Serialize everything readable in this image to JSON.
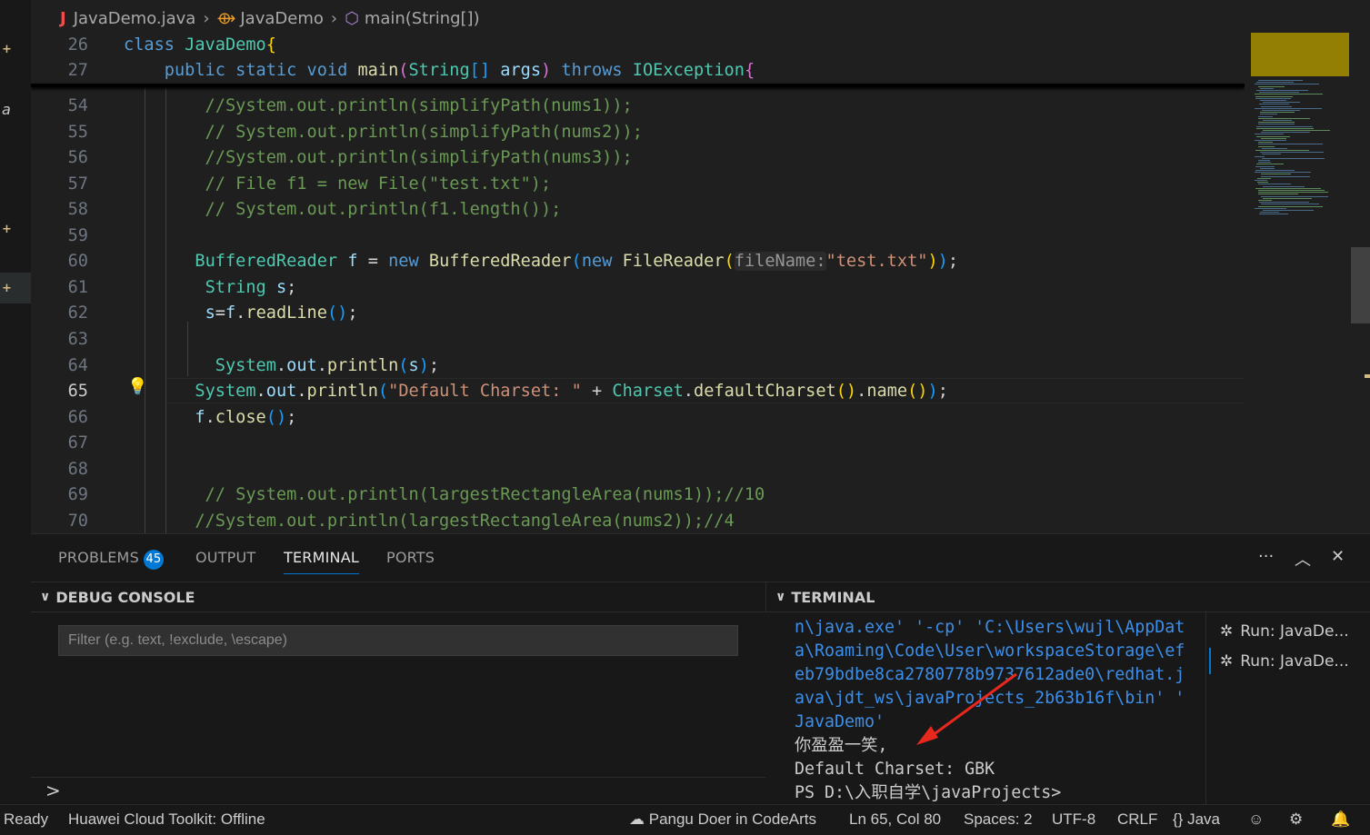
{
  "breadcrumb": {
    "file": "JavaDemo.java",
    "class": "JavaDemo",
    "method": "main(String[])"
  },
  "editor": {
    "sticky": [
      {
        "num": "26",
        "tokens": [
          [
            "kw",
            "class "
          ],
          [
            "ty",
            "JavaDemo"
          ],
          [
            "br1",
            "{"
          ]
        ]
      },
      {
        "num": "27",
        "tokens": [
          [
            "pun",
            "    "
          ],
          [
            "kw",
            "public static void "
          ],
          [
            "fn",
            "main"
          ],
          [
            "br2",
            "("
          ],
          [
            "ty",
            "String"
          ],
          [
            "br3",
            "[]"
          ],
          [
            "pun",
            " "
          ],
          [
            "var",
            "args"
          ],
          [
            "br2",
            ")"
          ],
          [
            "pun",
            " "
          ],
          [
            "kw",
            "throws "
          ],
          [
            "ty",
            "IOException"
          ],
          [
            "br2",
            "{"
          ]
        ]
      }
    ],
    "lines": [
      {
        "num": "54",
        "tokens": [
          [
            "com",
            "        //System.out.println(simplifyPath(nums1));"
          ]
        ]
      },
      {
        "num": "55",
        "tokens": [
          [
            "com",
            "        // System.out.println(simplifyPath(nums2));"
          ]
        ]
      },
      {
        "num": "56",
        "tokens": [
          [
            "com",
            "        //System.out.println(simplifyPath(nums3));"
          ]
        ]
      },
      {
        "num": "57",
        "tokens": [
          [
            "com",
            "        // File f1 = new File(\"test.txt\");"
          ]
        ]
      },
      {
        "num": "58",
        "tokens": [
          [
            "com",
            "        // System.out.println(f1.length());"
          ]
        ]
      },
      {
        "num": "59",
        "tokens": []
      },
      {
        "num": "60",
        "tokens": [
          [
            "pun",
            "       "
          ],
          [
            "ty",
            "BufferedReader"
          ],
          [
            "pun",
            " "
          ],
          [
            "var",
            "f"
          ],
          [
            "pun",
            " = "
          ],
          [
            "kw",
            "new "
          ],
          [
            "fn",
            "BufferedReader"
          ],
          [
            "br3",
            "("
          ],
          [
            "kw",
            "new "
          ],
          [
            "fn",
            "FileReader"
          ],
          [
            "br1",
            "("
          ],
          [
            "hint",
            "fileName:"
          ],
          [
            "str",
            "\"test.txt\""
          ],
          [
            "br1",
            ")"
          ],
          [
            "br3",
            ")"
          ],
          [
            "pun",
            ";"
          ]
        ]
      },
      {
        "num": "61",
        "tokens": [
          [
            "pun",
            "        "
          ],
          [
            "ty",
            "String"
          ],
          [
            "pun",
            " "
          ],
          [
            "var",
            "s"
          ],
          [
            "pun",
            ";"
          ]
        ]
      },
      {
        "num": "62",
        "tokens": [
          [
            "pun",
            "        "
          ],
          [
            "var",
            "s"
          ],
          [
            "pun",
            "="
          ],
          [
            "var",
            "f"
          ],
          [
            "pun",
            "."
          ],
          [
            "fn",
            "readLine"
          ],
          [
            "br3",
            "()"
          ],
          [
            "pun",
            ";"
          ]
        ]
      },
      {
        "num": "63",
        "tokens": []
      },
      {
        "num": "64",
        "tokens": [
          [
            "pun",
            "         "
          ],
          [
            "ty",
            "System"
          ],
          [
            "pun",
            "."
          ],
          [
            "var",
            "out"
          ],
          [
            "pun",
            "."
          ],
          [
            "fn",
            "println"
          ],
          [
            "br3",
            "("
          ],
          [
            "var",
            "s"
          ],
          [
            "br3",
            ")"
          ],
          [
            "pun",
            ";"
          ]
        ]
      },
      {
        "num": "65",
        "tokens": [
          [
            "pun",
            "       "
          ],
          [
            "ty",
            "System"
          ],
          [
            "pun",
            "."
          ],
          [
            "var",
            "out"
          ],
          [
            "pun",
            "."
          ],
          [
            "fn",
            "println"
          ],
          [
            "br3",
            "("
          ],
          [
            "str",
            "\"Default Charset: \""
          ],
          [
            "pun",
            " + "
          ],
          [
            "ty",
            "Charset"
          ],
          [
            "pun",
            "."
          ],
          [
            "fn",
            "defaultCharset"
          ],
          [
            "br1",
            "()"
          ],
          [
            "pun",
            "."
          ],
          [
            "fn",
            "name"
          ],
          [
            "br1",
            "()"
          ],
          [
            "br3",
            ")"
          ],
          [
            "pun",
            ";"
          ]
        ]
      },
      {
        "num": "66",
        "tokens": [
          [
            "pun",
            "       "
          ],
          [
            "var",
            "f"
          ],
          [
            "pun",
            "."
          ],
          [
            "fn",
            "close"
          ],
          [
            "br3",
            "()"
          ],
          [
            "pun",
            ";"
          ]
        ]
      },
      {
        "num": "67",
        "tokens": []
      },
      {
        "num": "68",
        "tokens": []
      },
      {
        "num": "69",
        "tokens": [
          [
            "com",
            "        // System.out.println(largestRectangleArea(nums1));//10"
          ]
        ]
      },
      {
        "num": "70",
        "tokens": [
          [
            "com",
            "       //System.out.println(largestRectangleArea(nums2));//4"
          ]
        ]
      }
    ],
    "current_line": "65"
  },
  "panel": {
    "tabs": [
      "PROBLEMS",
      "OUTPUT",
      "TERMINAL",
      "PORTS"
    ],
    "problems_count": "45",
    "active_tab": "TERMINAL",
    "debug_console_title": "DEBUG CONSOLE",
    "filter_placeholder": "Filter (e.g. text, !exclude, \\escape)",
    "debug_prompt": ">",
    "terminal_title": "TERMINAL",
    "terminal_lines": [
      {
        "text": "n\\java.exe' '-cp' 'C:\\Users\\wujl\\AppDat",
        "color": "t-blue"
      },
      {
        "text": "a\\Roaming\\Code\\User\\workspaceStorage\\ef",
        "color": "t-blue"
      },
      {
        "text": "eb79bdbe8ca2780778b9737612ade0\\redhat.j",
        "color": "t-blue"
      },
      {
        "text": "ava\\jdt_ws\\javaProjects_2b63b16f\\bin' '",
        "color": "t-blue"
      },
      {
        "text": "JavaDemo'",
        "color": "t-blue"
      },
      {
        "text": "你盈盈一笑,",
        "color": "t-white"
      },
      {
        "text": "Default Charset: GBK",
        "color": "t-white"
      },
      {
        "text": "PS D:\\入职自学\\javaProjects>",
        "color": "t-white"
      }
    ],
    "terminals": [
      {
        "label": "Run: JavaDe...",
        "selected": false
      },
      {
        "label": "Run: JavaDe...",
        "selected": true
      }
    ]
  },
  "statusbar": {
    "ready": "Ready",
    "huawei": "Huawei Cloud Toolkit: Offline",
    "pangu": "Pangu Doer in CodeArts",
    "position": "Ln 65, Col 80",
    "spaces": "Spaces: 2",
    "encoding": "UTF-8",
    "eol": "CRLF",
    "language": "Java",
    "language_icon": "{}"
  },
  "colors": {
    "accent": "#0078d4",
    "arrow": "#e8281c",
    "terminal_blue": "#3b8eea"
  }
}
